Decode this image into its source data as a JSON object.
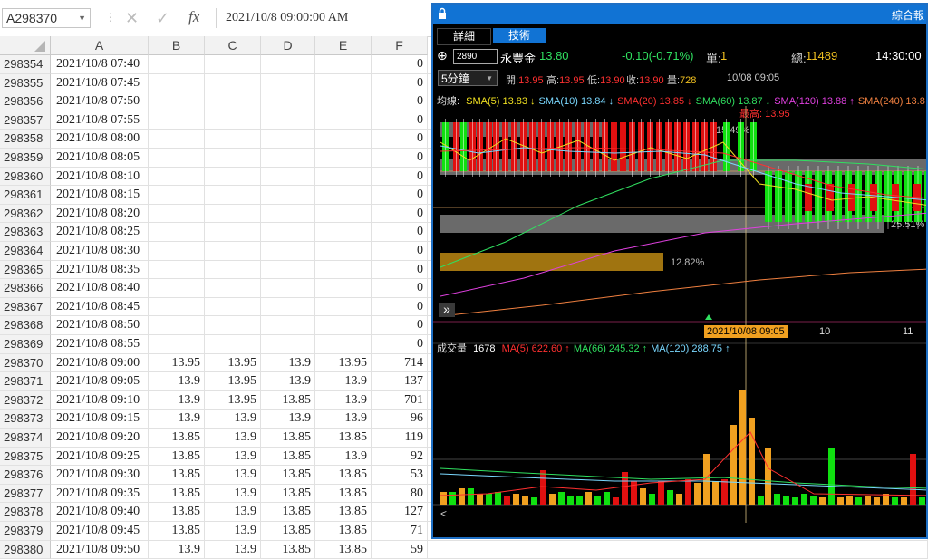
{
  "excel": {
    "name_box": "A298370",
    "formula_value": "2021/10/8  09:00:00 AM",
    "columns": [
      "A",
      "B",
      "C",
      "D",
      "E",
      "F"
    ],
    "rows": [
      {
        "n": "298354",
        "a": "2021/10/8 07:40",
        "b": "",
        "c": "",
        "d": "",
        "e": "",
        "f": "0"
      },
      {
        "n": "298355",
        "a": "2021/10/8 07:45",
        "b": "",
        "c": "",
        "d": "",
        "e": "",
        "f": "0"
      },
      {
        "n": "298356",
        "a": "2021/10/8 07:50",
        "b": "",
        "c": "",
        "d": "",
        "e": "",
        "f": "0"
      },
      {
        "n": "298357",
        "a": "2021/10/8 07:55",
        "b": "",
        "c": "",
        "d": "",
        "e": "",
        "f": "0"
      },
      {
        "n": "298358",
        "a": "2021/10/8 08:00",
        "b": "",
        "c": "",
        "d": "",
        "e": "",
        "f": "0"
      },
      {
        "n": "298359",
        "a": "2021/10/8 08:05",
        "b": "",
        "c": "",
        "d": "",
        "e": "",
        "f": "0"
      },
      {
        "n": "298360",
        "a": "2021/10/8 08:10",
        "b": "",
        "c": "",
        "d": "",
        "e": "",
        "f": "0"
      },
      {
        "n": "298361",
        "a": "2021/10/8 08:15",
        "b": "",
        "c": "",
        "d": "",
        "e": "",
        "f": "0"
      },
      {
        "n": "298362",
        "a": "2021/10/8 08:20",
        "b": "",
        "c": "",
        "d": "",
        "e": "",
        "f": "0"
      },
      {
        "n": "298363",
        "a": "2021/10/8 08:25",
        "b": "",
        "c": "",
        "d": "",
        "e": "",
        "f": "0"
      },
      {
        "n": "298364",
        "a": "2021/10/8 08:30",
        "b": "",
        "c": "",
        "d": "",
        "e": "",
        "f": "0"
      },
      {
        "n": "298365",
        "a": "2021/10/8 08:35",
        "b": "",
        "c": "",
        "d": "",
        "e": "",
        "f": "0"
      },
      {
        "n": "298366",
        "a": "2021/10/8 08:40",
        "b": "",
        "c": "",
        "d": "",
        "e": "",
        "f": "0"
      },
      {
        "n": "298367",
        "a": "2021/10/8 08:45",
        "b": "",
        "c": "",
        "d": "",
        "e": "",
        "f": "0"
      },
      {
        "n": "298368",
        "a": "2021/10/8 08:50",
        "b": "",
        "c": "",
        "d": "",
        "e": "",
        "f": "0"
      },
      {
        "n": "298369",
        "a": "2021/10/8 08:55",
        "b": "",
        "c": "",
        "d": "",
        "e": "",
        "f": "0"
      },
      {
        "n": "298370",
        "a": "2021/10/8 09:00",
        "b": "13.95",
        "c": "13.95",
        "d": "13.9",
        "e": "13.95",
        "f": "714"
      },
      {
        "n": "298371",
        "a": "2021/10/8 09:05",
        "b": "13.9",
        "c": "13.95",
        "d": "13.9",
        "e": "13.9",
        "f": "137"
      },
      {
        "n": "298372",
        "a": "2021/10/8 09:10",
        "b": "13.9",
        "c": "13.95",
        "d": "13.85",
        "e": "13.9",
        "f": "701"
      },
      {
        "n": "298373",
        "a": "2021/10/8 09:15",
        "b": "13.9",
        "c": "13.9",
        "d": "13.9",
        "e": "13.9",
        "f": "96"
      },
      {
        "n": "298374",
        "a": "2021/10/8 09:20",
        "b": "13.85",
        "c": "13.9",
        "d": "13.85",
        "e": "13.85",
        "f": "119"
      },
      {
        "n": "298375",
        "a": "2021/10/8 09:25",
        "b": "13.85",
        "c": "13.9",
        "d": "13.85",
        "e": "13.9",
        "f": "92"
      },
      {
        "n": "298376",
        "a": "2021/10/8 09:30",
        "b": "13.85",
        "c": "13.9",
        "d": "13.85",
        "e": "13.85",
        "f": "53"
      },
      {
        "n": "298377",
        "a": "2021/10/8 09:35",
        "b": "13.85",
        "c": "13.9",
        "d": "13.85",
        "e": "13.85",
        "f": "80"
      },
      {
        "n": "298378",
        "a": "2021/10/8 09:40",
        "b": "13.85",
        "c": "13.9",
        "d": "13.85",
        "e": "13.85",
        "f": "127"
      },
      {
        "n": "298379",
        "a": "2021/10/8 09:45",
        "b": "13.85",
        "c": "13.9",
        "d": "13.85",
        "e": "13.85",
        "f": "71"
      },
      {
        "n": "298380",
        "a": "2021/10/8 09:50",
        "b": "13.9",
        "c": "13.9",
        "d": "13.85",
        "e": "13.85",
        "f": "59"
      }
    ]
  },
  "stock": {
    "title": "綜合報",
    "tabs": [
      "詳細",
      "技術"
    ],
    "code": "2890",
    "name": "永豐金",
    "price": "13.80",
    "change": "-0.10(-0.71%)",
    "single_label": "單:",
    "single_value": "1",
    "total_label": "總:",
    "total_value": "11489",
    "time": "14:30:00",
    "period": "5分鐘",
    "ohlc": [
      {
        "label": "開:",
        "value": "13.95",
        "color": "#ff3030"
      },
      {
        "label": "高:",
        "value": "13.95",
        "color": "#ff3030"
      },
      {
        "label": "低:",
        "value": "13.90",
        "color": "#ff3030"
      },
      {
        "label": "收:",
        "value": "13.90",
        "color": "#ff3030"
      },
      {
        "label": "量:",
        "value": "728",
        "color": "#f0c020"
      }
    ],
    "bar_time": "10/08 09:05",
    "ma_label": "均線:",
    "ma": [
      {
        "text": "SMA(5) 13.83 ↓",
        "color": "#f0e020"
      },
      {
        "text": "SMA(10) 13.84 ↓",
        "color": "#7ad8ff"
      },
      {
        "text": "SMA(20) 13.85 ↓",
        "color": "#ff3030"
      },
      {
        "text": "SMA(60) 13.87 ↓",
        "color": "#30e060"
      },
      {
        "text": "SMA(120) 13.88 ↑",
        "color": "#e040e0"
      },
      {
        "text": "SMA(240) 13.8",
        "color": "#f08040"
      }
    ],
    "high_note": "最高: 13.95",
    "pct_labels": [
      "15.49%",
      "25.51%",
      "12.82%"
    ],
    "cursor_date": "2021/10/08 09:05",
    "x_labels": [
      "10",
      "11"
    ],
    "vol_label": "成交量",
    "vol_value": "1678",
    "vol_ma": [
      {
        "text": "MA(5) 622.60 ↑",
        "color": "#ff3030"
      },
      {
        "text": "MA(66) 245.32 ↑",
        "color": "#30e060"
      },
      {
        "text": "MA(120) 288.75 ↑",
        "color": "#7ad8ff"
      }
    ],
    "colors": {
      "up": "#e01010",
      "down": "#10e010",
      "neutral": "#f0a020",
      "title_bar": "#1173d4"
    }
  }
}
